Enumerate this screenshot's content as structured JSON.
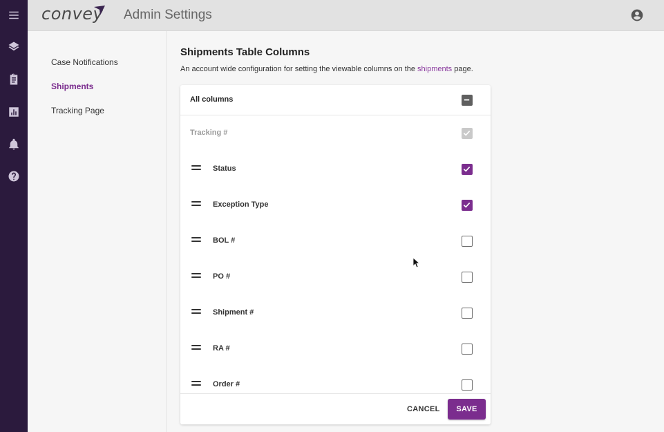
{
  "app": {
    "logo_text": "convey",
    "page_title": "Admin Settings"
  },
  "nav_rail": {
    "items": [
      "menu-icon",
      "layers-icon",
      "clipboard-icon",
      "chart-icon",
      "bell-icon",
      "help-icon"
    ]
  },
  "subnav": {
    "items": [
      {
        "label": "Case Notifications",
        "active": false
      },
      {
        "label": "Shipments",
        "active": true
      },
      {
        "label": "Tracking Page",
        "active": false
      }
    ]
  },
  "section": {
    "title": "Shipments Table Columns",
    "desc_before": "An account wide configuration for setting the viewable columns on the ",
    "desc_link": "shipments",
    "desc_after": " page."
  },
  "columns_card": {
    "all_label": "All columns",
    "all_state": "indeterminate",
    "locked_row": {
      "label": "Tracking #",
      "checked": true,
      "disabled": true
    },
    "rows": [
      {
        "label": "Status",
        "checked": true
      },
      {
        "label": "Exception Type",
        "checked": true
      },
      {
        "label": "BOL #",
        "checked": false
      },
      {
        "label": "PO #",
        "checked": false
      },
      {
        "label": "Shipment #",
        "checked": false
      },
      {
        "label": "RA #",
        "checked": false
      },
      {
        "label": "Order #",
        "checked": false
      }
    ],
    "cancel_label": "CANCEL",
    "save_label": "SAVE"
  },
  "colors": {
    "accent": "#7b2d8e",
    "rail": "#2b1a3d",
    "topbar": "#e2e2e2"
  }
}
